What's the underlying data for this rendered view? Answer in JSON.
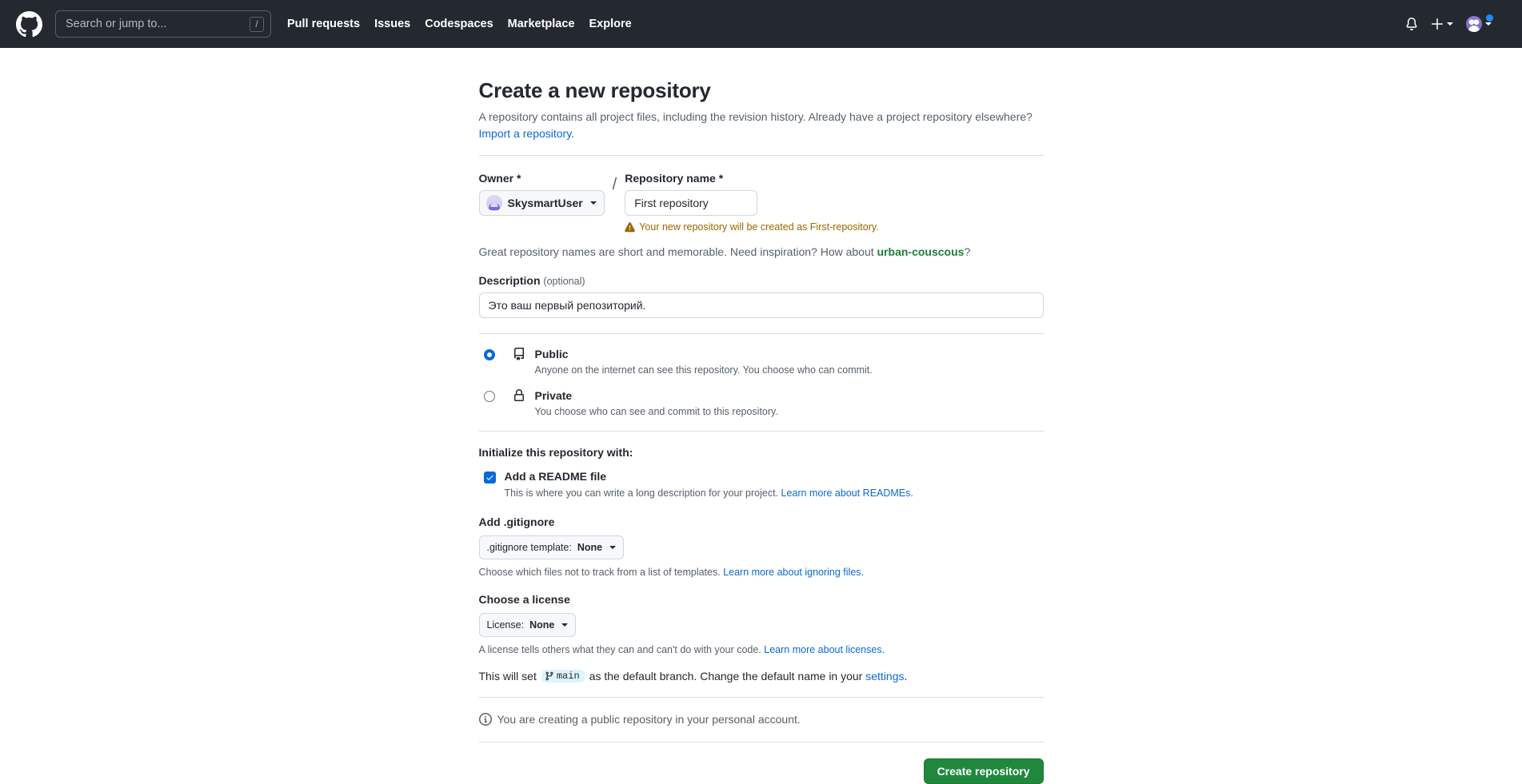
{
  "header": {
    "logo_icon": "github-mark-icon",
    "search": {
      "placeholder": "Search or jump to...",
      "shortcut": "/"
    },
    "nav": [
      {
        "label": "Pull requests"
      },
      {
        "label": "Issues"
      },
      {
        "label": "Codespaces"
      },
      {
        "label": "Marketplace"
      },
      {
        "label": "Explore"
      }
    ],
    "notifications_icon": "bell-icon",
    "create_new_icon": "plus-icon",
    "avatar_icon": "user-avatar",
    "background_color": "#24292f"
  },
  "page": {
    "title": "Create a new repository",
    "lede": "A repository contains all project files, including the revision history. Already have a project repository elsewhere?",
    "import_link": "Import a repository."
  },
  "owner": {
    "label": "Owner",
    "required_mark": "*",
    "selected": "SkysmartUser",
    "avatar_icon": "owner-avatar-icon",
    "chevron_icon": "chevron-down-icon",
    "separator": "/"
  },
  "repo_name": {
    "label": "Repository name",
    "required_mark": "*",
    "value": "First repository",
    "warning_icon": "alert-triangle-icon",
    "warning": "Your new repository will be created as First-repository.",
    "warning_color": "#9a6700"
  },
  "suggestion": {
    "text_before": "Great repository names are short and memorable. Need inspiration? How about ",
    "name": "urban-couscous",
    "text_after": "?",
    "name_color": "#1a7f37"
  },
  "description": {
    "label": "Description",
    "optional": "(optional)",
    "value": "Это ваш первый репозиторий."
  },
  "visibility": {
    "options": [
      {
        "title": "Public",
        "icon": "repo-book-icon",
        "subtitle": "Anyone on the internet can see this repository. You choose who can commit.",
        "selected": true
      },
      {
        "title": "Private",
        "icon": "lock-icon",
        "subtitle": "You choose who can see and commit to this repository.",
        "selected": false
      }
    ]
  },
  "initialize": {
    "heading": "Initialize this repository with:",
    "readme": {
      "label": "Add a README file",
      "checked": true,
      "check_icon": "check-icon",
      "description": "This is where you can write a long description for your project.",
      "link": "Learn more about READMEs."
    },
    "gitignore": {
      "heading": "Add .gitignore",
      "button_prefix": ".gitignore template:",
      "button_value": "None",
      "chevron_icon": "chevron-down-icon",
      "help": "Choose which files not to track from a list of templates.",
      "link": "Learn more about ignoring files."
    },
    "license": {
      "heading": "Choose a license",
      "button_prefix": "License:",
      "button_value": "None",
      "chevron_icon": "chevron-down-icon",
      "help": "A license tells others what they can and can't do with your code.",
      "link": "Learn more about licenses."
    }
  },
  "branch": {
    "text_before": "This will set",
    "badge_icon": "git-branch-icon",
    "badge": "main",
    "text_middle": "as the default branch. Change the default name in your",
    "link": "settings",
    "text_after": ".",
    "badge_bg": "#ddf4ff"
  },
  "notice": {
    "icon": "info-circle-icon",
    "text": "You are creating a public repository in your personal account."
  },
  "footer": {
    "create_button": "Create repository",
    "button_color": "#1f883d"
  }
}
